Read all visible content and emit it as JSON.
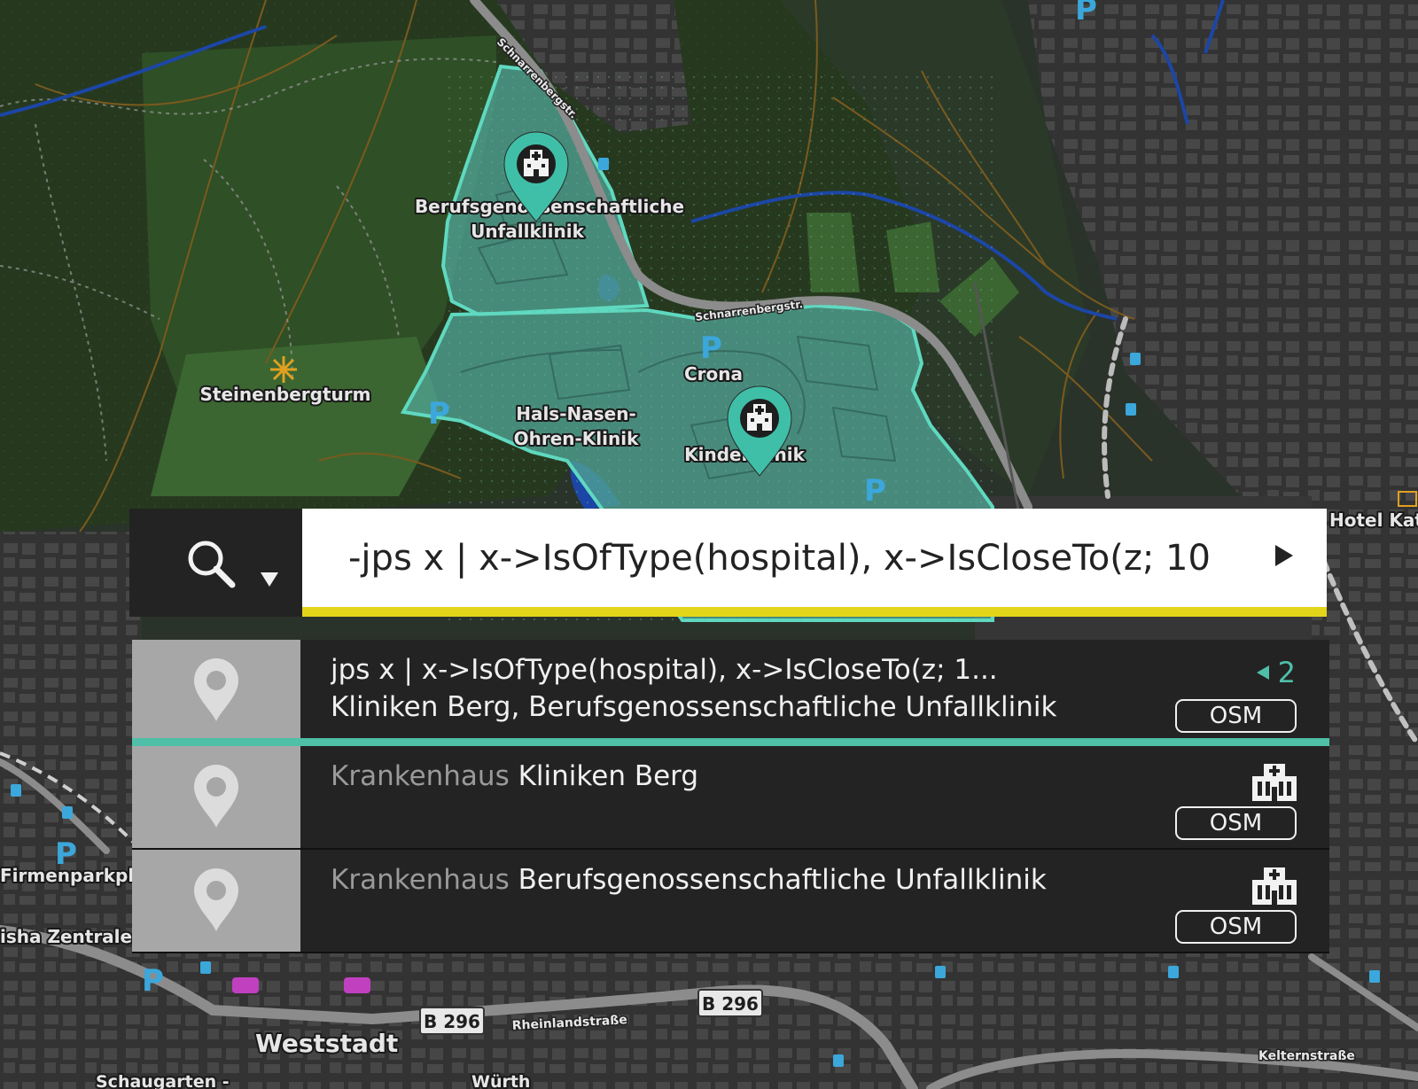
{
  "map": {
    "labels": {
      "bgu_line1": "Berufsgenossenschaftliche",
      "bgu_line2": "Unfallklinik",
      "steinenbergturm": "Steinenbergturm",
      "crona": "Crona",
      "hno_line1": "Hals-Nasen-",
      "hno_line2": "Ohren-Klinik",
      "kinderklinik": "Kinderklinik",
      "hotel": "Hotel Katha",
      "firmenparkplatz": "Firmenparkplatz",
      "zentrale": "isha Zentrale",
      "weststadt": "Weststadt",
      "schaugarten": "Schaugarten -",
      "wuerth": "Würth",
      "schnarrenberg1": "Schnarrenbergstr.",
      "schnarrenberg2": "Schnarrenbergstr.",
      "rheinland": "Rheinlandstraße",
      "kelternstrasse": "Kelternstraße",
      "b296a": "B 296",
      "b296b": "B 296",
      "parking": "P"
    },
    "colors": {
      "forest": "#26391f",
      "forest_light": "#2f5524",
      "meadow": "#3c6a34",
      "urban": "#3a3a3a",
      "hospital_fill": "#4fa393",
      "hospital_stroke": "#5fd9c0",
      "road": "#8c8c8c",
      "water": "#1c46a6",
      "contour": "#7a5a1e",
      "parking": "#3ba7db",
      "marker": "#3fbfa8"
    }
  },
  "search": {
    "query": "-jps x | x->IsOfType(hospital), x->IsCloseTo(z; 10",
    "icon": "search-icon",
    "dropdown_icon": "caret-down-icon",
    "run_icon": "play-icon"
  },
  "results": [
    {
      "title": "jps x | x->IsOfType(hospital), x->IsCloseTo(z; 1...",
      "subtitle": "Kliniken Berg, Berufsgenossenschaftliche Unfallklinik",
      "count": "2",
      "badge": "OSM",
      "icon": "map-pin-icon",
      "active": true
    },
    {
      "category": "Krankenhaus",
      "name": "Kliniken Berg",
      "badge": "OSM",
      "icon": "map-pin-icon",
      "type_icon": "hospital-icon"
    },
    {
      "category": "Krankenhaus",
      "name": "Berufsgenossenschaftliche Unfallklinik",
      "badge": "OSM",
      "icon": "map-pin-icon",
      "type_icon": "hospital-icon"
    }
  ]
}
